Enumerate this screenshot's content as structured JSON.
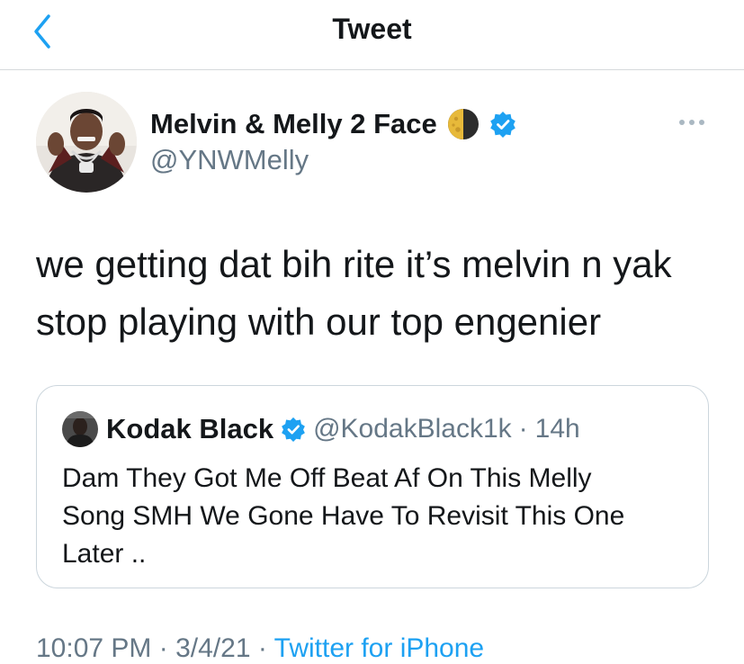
{
  "header": {
    "title": "Tweet"
  },
  "tweet": {
    "author_name": "Melvin & Melly 2 Face",
    "author_handle": "@YNWMelly",
    "text_lines": [
      "we getting dat bih rite it’s melvin n yak",
      "stop playing with our top engenier"
    ],
    "icons": {
      "back": "chevron-left-icon",
      "moon": "half-moon-emoji",
      "verified": "verified-badge-icon",
      "more": "more-options-icon"
    }
  },
  "quoted_tweet": {
    "author_name": "Kodak Black",
    "author_handle": "@KodakBlack1k",
    "separator": "·",
    "age": "14h",
    "text_lines": [
      "Dam They Got Me Off Beat Af On This Melly",
      "Song SMH We Gone Have To Revisit This One",
      "Later .."
    ]
  },
  "footer": {
    "time": "10:07 PM",
    "date": "3/4/21",
    "separator": "·",
    "source": "Twitter for iPhone"
  },
  "colors": {
    "accent": "#1da1f2",
    "secondary_text": "#657786",
    "border": "#ccd6dd"
  }
}
